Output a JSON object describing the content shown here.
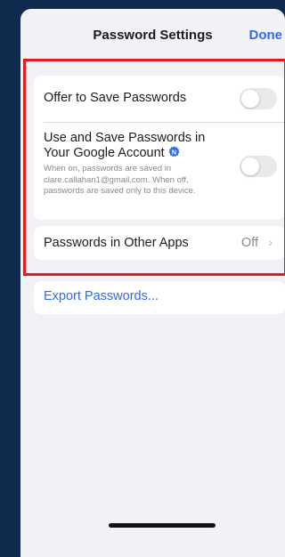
{
  "nav": {
    "title": "Password Settings",
    "done_label": "Done"
  },
  "settings": {
    "offer_to_save": {
      "label": "Offer to Save Passwords",
      "toggle_on": false
    },
    "google_account": {
      "label_line1": "Use and Save Passwords in",
      "label_line2": "Your Google Account",
      "description": "When on, passwords are saved in clare.callahan1@gmail.com. When off, passwords are saved only to this device.",
      "badge_letter": "N",
      "toggle_on": false
    },
    "other_apps": {
      "label": "Passwords in Other Apps",
      "value": "Off",
      "chevron": "›"
    },
    "export": {
      "label": "Export Passwords..."
    }
  },
  "colors": {
    "accent": "#2f6ce8",
    "highlight_box": "#e61a1a",
    "frame": "#0f2a4d",
    "background": "#f2f2f6"
  },
  "icons": {
    "new_badge": "new-badge-icon",
    "chevron": "chevron-right-icon"
  }
}
